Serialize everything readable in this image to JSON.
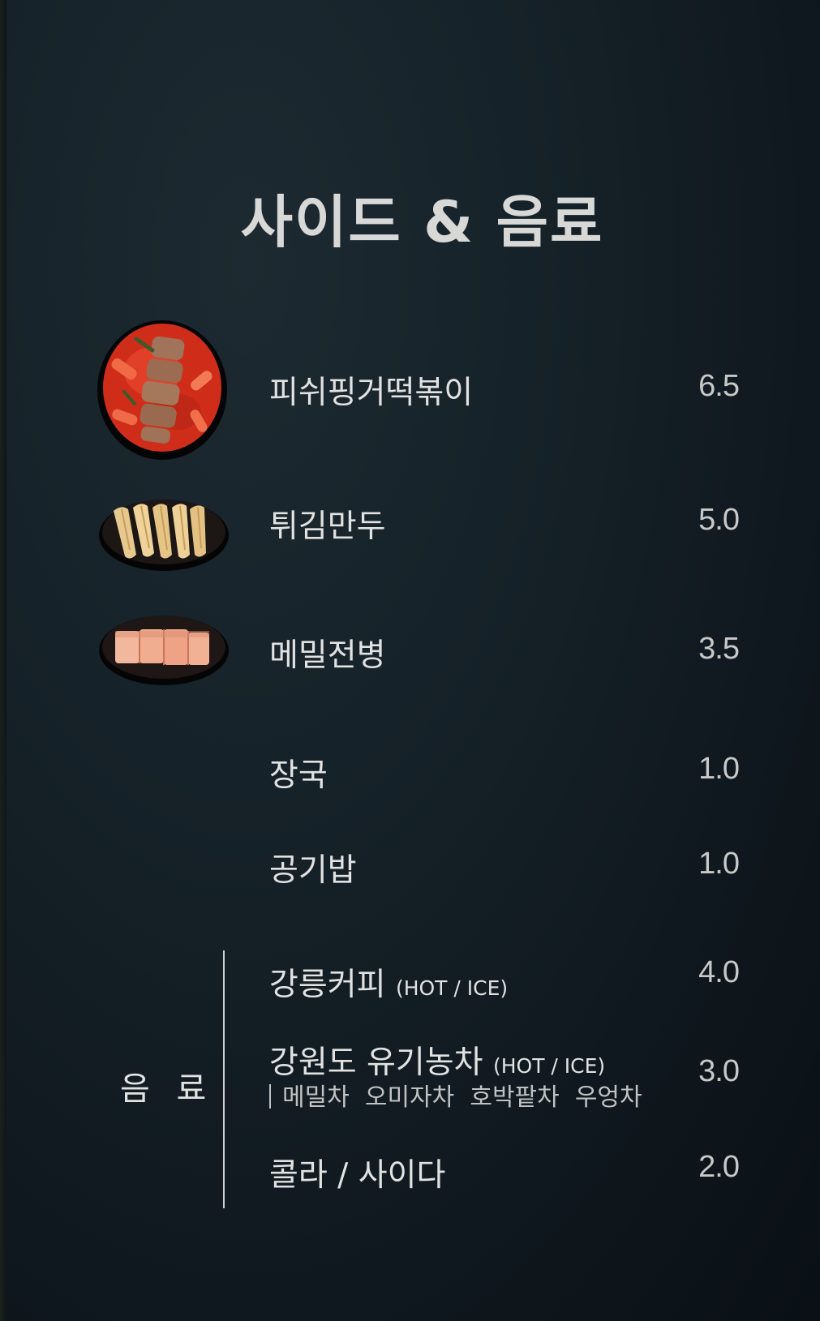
{
  "menu": {
    "title": "사이드 & 음료",
    "sides": [
      {
        "name": "피쉬핑거떡볶이",
        "price": "6.5",
        "image": "fish-finger-tteokbokki-photo"
      },
      {
        "name": "튀김만두",
        "price": "5.0",
        "image": "fried-dumplings-photo"
      },
      {
        "name": "메밀전병",
        "price": "3.5",
        "image": "buckwheat-crepe-photo"
      },
      {
        "name": "장국",
        "price": "1.0"
      },
      {
        "name": "공기밥",
        "price": "1.0"
      }
    ],
    "drinks": {
      "label": "음 료",
      "items": [
        {
          "name": "강릉커피",
          "note": "(HOT / ICE)",
          "price": "4.0"
        },
        {
          "name": "강원도 유기농차",
          "note": "(HOT / ICE)",
          "price": "3.0",
          "sub": "메밀차  오미자차  호박팥차  우엉차"
        },
        {
          "name": "콜라 / 사이다",
          "price": "2.0"
        }
      ]
    }
  },
  "colors": {
    "background": "#131d23",
    "text": "#e2e2e0",
    "price": "#c8c8c6"
  }
}
